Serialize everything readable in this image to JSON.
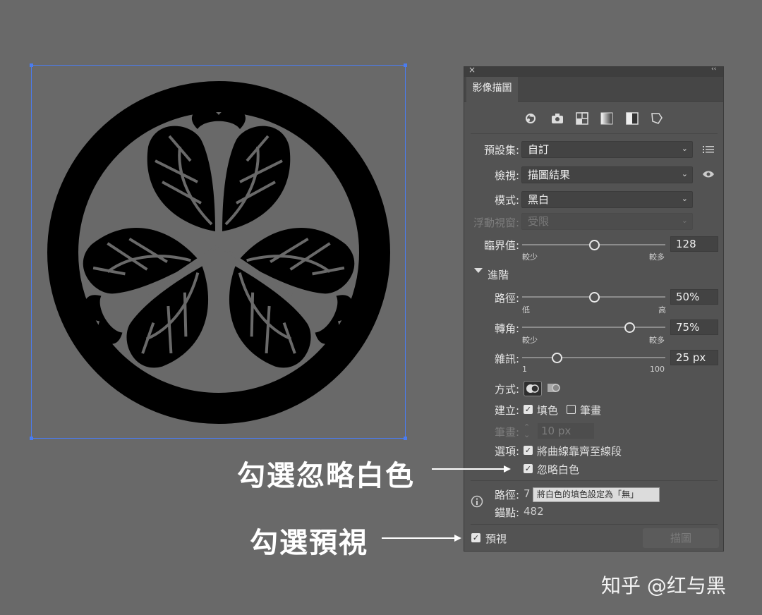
{
  "panel": {
    "tab_label": "影像描圖",
    "close_glyph": "×",
    "collapse_glyph": "‹‹",
    "icons": [
      "auto-color-icon",
      "high-color-icon",
      "low-color-icon",
      "grayscale-icon",
      "black-white-icon",
      "outline-icon"
    ],
    "rows": {
      "preset": {
        "label": "預設集:",
        "value": "自訂"
      },
      "view": {
        "label": "檢視:",
        "value": "描圖結果"
      },
      "mode": {
        "label": "模式:",
        "value": "黑白"
      },
      "palette": {
        "label": "浮動視窗:",
        "value": "受限"
      },
      "threshold": {
        "label": "臨界值:",
        "value": "128",
        "min_label": "較少",
        "max_label": "較多",
        "level": 128,
        "range": [
          0,
          255
        ]
      }
    },
    "advanced_label": "進階",
    "advanced": {
      "paths": {
        "label": "路徑:",
        "value": "50%",
        "min_label": "低",
        "max_label": "高",
        "level": 50
      },
      "corners": {
        "label": "轉角:",
        "value": "75%",
        "min_label": "較少",
        "max_label": "較多",
        "level": 75
      },
      "noise": {
        "label": "雜訊:",
        "value": "25 px",
        "min_label": "1",
        "max_label": "100",
        "level": 25
      },
      "method_label": "方式:",
      "create": {
        "label": "建立:",
        "fills_label": "填色",
        "fills_checked": true,
        "strokes_label": "筆畫",
        "strokes_checked": false
      },
      "stroke": {
        "label": "筆畫:",
        "value": "10 px"
      },
      "options": {
        "label": "選項:",
        "snap_label": "將曲線靠齊至線段",
        "snap_checked": true,
        "ignore_white_label": "忽略白色",
        "ignore_white_checked": true
      }
    },
    "info": {
      "paths_label": "路徑:",
      "paths_value": "7",
      "anchors_label": "錨點:",
      "anchors_value": "482"
    },
    "tooltip": "將白色的填色設定為「無」",
    "preview_label": "預視",
    "preview_checked": true,
    "trace_button": "描圖"
  },
  "callouts": {
    "ignore_white": "勾選忽略白色",
    "preview": "勾選預視"
  },
  "watermark": "知乎 @红与黑",
  "colors": {
    "background": "#696969",
    "artwork": "#000000",
    "selection": "#4a7cf0",
    "panel": "#535353"
  }
}
